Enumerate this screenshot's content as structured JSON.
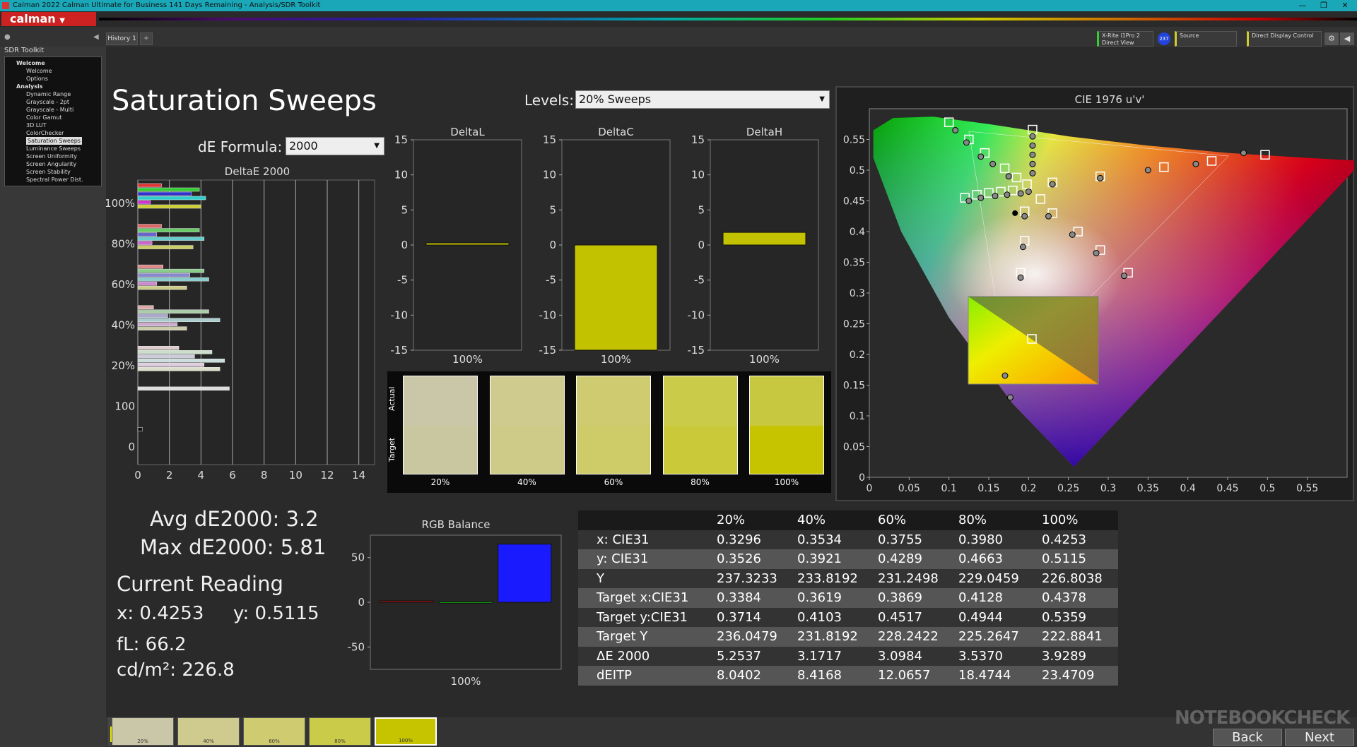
{
  "window": {
    "title": "Calman 2022 Calman Ultimate for Business 141 Days Remaining  - Analysis/SDR Toolkit",
    "min": "—",
    "max": "❐",
    "close": "✕"
  },
  "app": {
    "logo": "calman"
  },
  "tabs": {
    "history": "History 1",
    "add": "+"
  },
  "devices": {
    "meter_line1": "X-Rite i1Pro 2",
    "meter_line2": "Direct View",
    "meter_badge": "237",
    "source": "Source",
    "display": "Direct Display Control"
  },
  "sidebar": {
    "title": "SDR Toolkit",
    "items": [
      {
        "label": "Welcome",
        "level": "h"
      },
      {
        "label": "Welcome",
        "level": "i"
      },
      {
        "label": "Options",
        "level": "i"
      },
      {
        "label": "Analysis",
        "level": "h"
      },
      {
        "label": "Dynamic Range",
        "level": "i"
      },
      {
        "label": "Grayscale - 2pt",
        "level": "i"
      },
      {
        "label": "Grayscale - Multi",
        "level": "i"
      },
      {
        "label": "Color Gamut",
        "level": "i"
      },
      {
        "label": "3D LUT",
        "level": "i"
      },
      {
        "label": "ColorChecker",
        "level": "i"
      },
      {
        "label": "Saturation Sweeps",
        "level": "i",
        "selected": true
      },
      {
        "label": "Luminance Sweeps",
        "level": "i"
      },
      {
        "label": "Screen Uniformity",
        "level": "i"
      },
      {
        "label": "Screen Angularity",
        "level": "i"
      },
      {
        "label": "Screen Stability",
        "level": "i"
      },
      {
        "label": "Spectral Power Dist.",
        "level": "i"
      }
    ]
  },
  "page": {
    "title": "Saturation Sweeps",
    "levels_label": "Levels:",
    "levels_value": "20% Sweeps",
    "de_label": "dE Formula:",
    "de_value": "2000"
  },
  "deltae_chart": {
    "title": "DeltaE 2000",
    "ylabels": [
      "100%",
      "80%",
      "60%",
      "40%",
      "20%",
      "100",
      "0"
    ],
    "xticks": [
      "0",
      "2",
      "4",
      "6",
      "8",
      "10",
      "12",
      "14"
    ],
    "xmax": 15,
    "groups": [
      {
        "bars": [
          {
            "v": 1.5,
            "c": "#d33"
          },
          {
            "v": 3.9,
            "c": "#3c3"
          },
          {
            "v": 3.4,
            "c": "#33c"
          },
          {
            "v": 4.3,
            "c": "#3cc"
          },
          {
            "v": 0.8,
            "c": "#c3c"
          },
          {
            "v": 4.0,
            "c": "#cc3"
          }
        ]
      },
      {
        "bars": [
          {
            "v": 1.5,
            "c": "#d66"
          },
          {
            "v": 3.9,
            "c": "#6c6"
          },
          {
            "v": 1.2,
            "c": "#66c"
          },
          {
            "v": 4.2,
            "c": "#6cc"
          },
          {
            "v": 0.9,
            "c": "#c6c"
          },
          {
            "v": 3.5,
            "c": "#cc6"
          }
        ]
      },
      {
        "bars": [
          {
            "v": 1.6,
            "c": "#d88"
          },
          {
            "v": 4.2,
            "c": "#8c8"
          },
          {
            "v": 3.3,
            "c": "#88c"
          },
          {
            "v": 4.5,
            "c": "#8cc"
          },
          {
            "v": 1.2,
            "c": "#c8c"
          },
          {
            "v": 3.1,
            "c": "#cc8"
          }
        ]
      },
      {
        "bars": [
          {
            "v": 1.0,
            "c": "#daa"
          },
          {
            "v": 4.5,
            "c": "#aca"
          },
          {
            "v": 1.9,
            "c": "#aac"
          },
          {
            "v": 5.2,
            "c": "#acc"
          },
          {
            "v": 2.5,
            "c": "#cac"
          },
          {
            "v": 3.1,
            "c": "#cca"
          }
        ]
      },
      {
        "bars": [
          {
            "v": 2.6,
            "c": "#dcc"
          },
          {
            "v": 4.7,
            "c": "#cdc"
          },
          {
            "v": 3.6,
            "c": "#ccd"
          },
          {
            "v": 5.5,
            "c": "#cdd"
          },
          {
            "v": 4.2,
            "c": "#dcd"
          },
          {
            "v": 5.2,
            "c": "#ddc"
          }
        ]
      },
      {
        "bars": [
          {
            "v": 5.8,
            "c": "#ddd"
          }
        ]
      },
      {
        "bars": [
          {
            "v": 0.3,
            "c": "#111"
          }
        ]
      }
    ]
  },
  "delta_small": [
    {
      "title": "DeltaL",
      "value": 0.3,
      "xlabel": "100%"
    },
    {
      "title": "DeltaC",
      "value": -15,
      "xlabel": "100%"
    },
    {
      "title": "DeltaH",
      "value": 1.8,
      "xlabel": "100%"
    }
  ],
  "delta_yticks": [
    "15",
    "10",
    "5",
    "0",
    "-5",
    "-10",
    "-15"
  ],
  "swatches": {
    "actual_label": "Actual",
    "target_label": "Target",
    "items": [
      {
        "label": "20%",
        "actual": "#c9c7a8",
        "target": "#c8c7a0"
      },
      {
        "label": "40%",
        "actual": "#cfcb8f",
        "target": "#cecb88"
      },
      {
        "label": "60%",
        "actual": "#cecb70",
        "target": "#cecc68"
      },
      {
        "label": "80%",
        "actual": "#cbcb4a",
        "target": "#c9c93a"
      },
      {
        "label": "100%",
        "actual": "#c8c840",
        "target": "#c6c400"
      }
    ]
  },
  "stats": {
    "avg": "Avg dE2000: 3.2",
    "max": "Max dE2000: 5.81",
    "current": "Current Reading",
    "x": "x: 0.4253",
    "y": "y: 0.5115",
    "fl": "fL: 66.2",
    "cdm": "cd/m²: 226.8"
  },
  "rgb_balance": {
    "title": "RGB Balance",
    "yticks": [
      "50",
      "0",
      "-50"
    ],
    "xlabel": "100%",
    "bars": [
      {
        "name": "R",
        "v": 1.5,
        "c": "#cc1111"
      },
      {
        "name": "G",
        "v": 0.5,
        "c": "#11aa11"
      },
      {
        "name": "B",
        "v": 65,
        "c": "#1a1aff"
      }
    ]
  },
  "table": {
    "headers": [
      "",
      "20%",
      "40%",
      "60%",
      "80%",
      "100%"
    ],
    "rows": [
      [
        "x: CIE31",
        "0.3296",
        "0.3534",
        "0.3755",
        "0.3980",
        "0.4253"
      ],
      [
        "y: CIE31",
        "0.3526",
        "0.3921",
        "0.4289",
        "0.4663",
        "0.5115"
      ],
      [
        "Y",
        "237.3233",
        "233.8192",
        "231.2498",
        "229.0459",
        "226.8038"
      ],
      [
        "Target x:CIE31",
        "0.3384",
        "0.3619",
        "0.3869",
        "0.4128",
        "0.4378"
      ],
      [
        "Target y:CIE31",
        "0.3714",
        "0.4103",
        "0.4517",
        "0.4944",
        "0.5359"
      ],
      [
        "Target Y",
        "236.0479",
        "231.8192",
        "228.2422",
        "225.2647",
        "222.8841"
      ],
      [
        "ΔE 2000",
        "5.2537",
        "3.1717",
        "3.0984",
        "3.5370",
        "3.9289"
      ],
      [
        "dEITP",
        "8.0402",
        "8.4168",
        "12.0657",
        "18.4744",
        "23.4709"
      ]
    ]
  },
  "cie": {
    "title": "CIE 1976 u'v'",
    "xticks": [
      "0",
      "0.05",
      "0.1",
      "0.15",
      "0.2",
      "0.25",
      "0.3",
      "0.35",
      "0.4",
      "0.45",
      "0.5",
      "0.55"
    ],
    "yticks": [
      "0.55",
      "0.5",
      "0.45",
      "0.4",
      "0.35",
      "0.3",
      "0.25",
      "0.2",
      "0.15",
      "0.1",
      "0.05",
      "0"
    ]
  },
  "bottom": {
    "labels": [
      "20%",
      "40%",
      "60%",
      "80%",
      "100%"
    ],
    "colors": [
      "#c9c7a8",
      "#cfcb8f",
      "#cecb70",
      "#cbcb4a",
      "#c6c400"
    ],
    "current": "#f0f000",
    "back": "Back",
    "next": "Next"
  },
  "watermark": "NOTEBOOKCHECK"
}
